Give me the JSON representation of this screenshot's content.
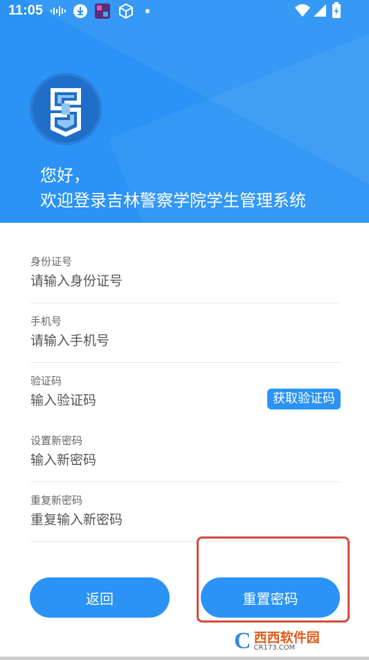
{
  "status_bar": {
    "time": "11:05"
  },
  "header": {
    "greeting_line1": "您好，",
    "greeting_line2": "欢迎登录吉林警察学院学生管理系统"
  },
  "form": {
    "id_card": {
      "label": "身份证号",
      "placeholder": "请输入身份证号"
    },
    "phone": {
      "label": "手机号",
      "placeholder": "请输入手机号"
    },
    "code": {
      "label": "验证码",
      "placeholder": "输入验证码",
      "button": "获取验证码"
    },
    "new_password": {
      "label": "设置新密码",
      "placeholder": "输入新密码"
    },
    "repeat_password": {
      "label": "重复新密码",
      "placeholder": "重复输入新密码"
    }
  },
  "buttons": {
    "back": "返回",
    "reset": "重置密码"
  },
  "watermark": {
    "main": "西西软件园",
    "sub": "CR173.COM"
  },
  "colors": {
    "primary": "#2a93f5",
    "highlight": "#d24a3a"
  }
}
